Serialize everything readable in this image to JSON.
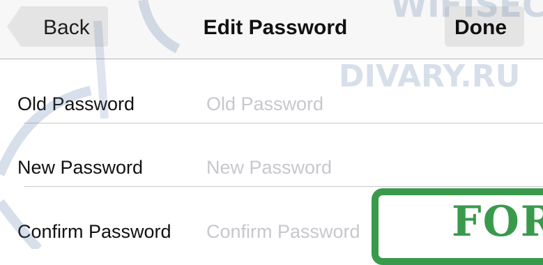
{
  "navbar": {
    "back_label": "Back",
    "title": "Edit Password",
    "done_label": "Done"
  },
  "form": {
    "rows": [
      {
        "label": "Old Password",
        "placeholder": "Old Password",
        "value": ""
      },
      {
        "label": "New Password",
        "placeholder": "New Password",
        "value": ""
      },
      {
        "label": "Confirm Password",
        "placeholder": "Confirm Password",
        "value": ""
      }
    ]
  },
  "watermark": {
    "site_top": "WIFISEC.",
    "site_bottom": "DIVARY.RU",
    "stamp": "FOR"
  },
  "colors": {
    "navbar_bg": "#f7f7f7",
    "button_bg": "#e4e4e4",
    "placeholder": "#c7c7cd",
    "separator": "#c8c7cc",
    "stamp_green": "#3a9a4c"
  }
}
